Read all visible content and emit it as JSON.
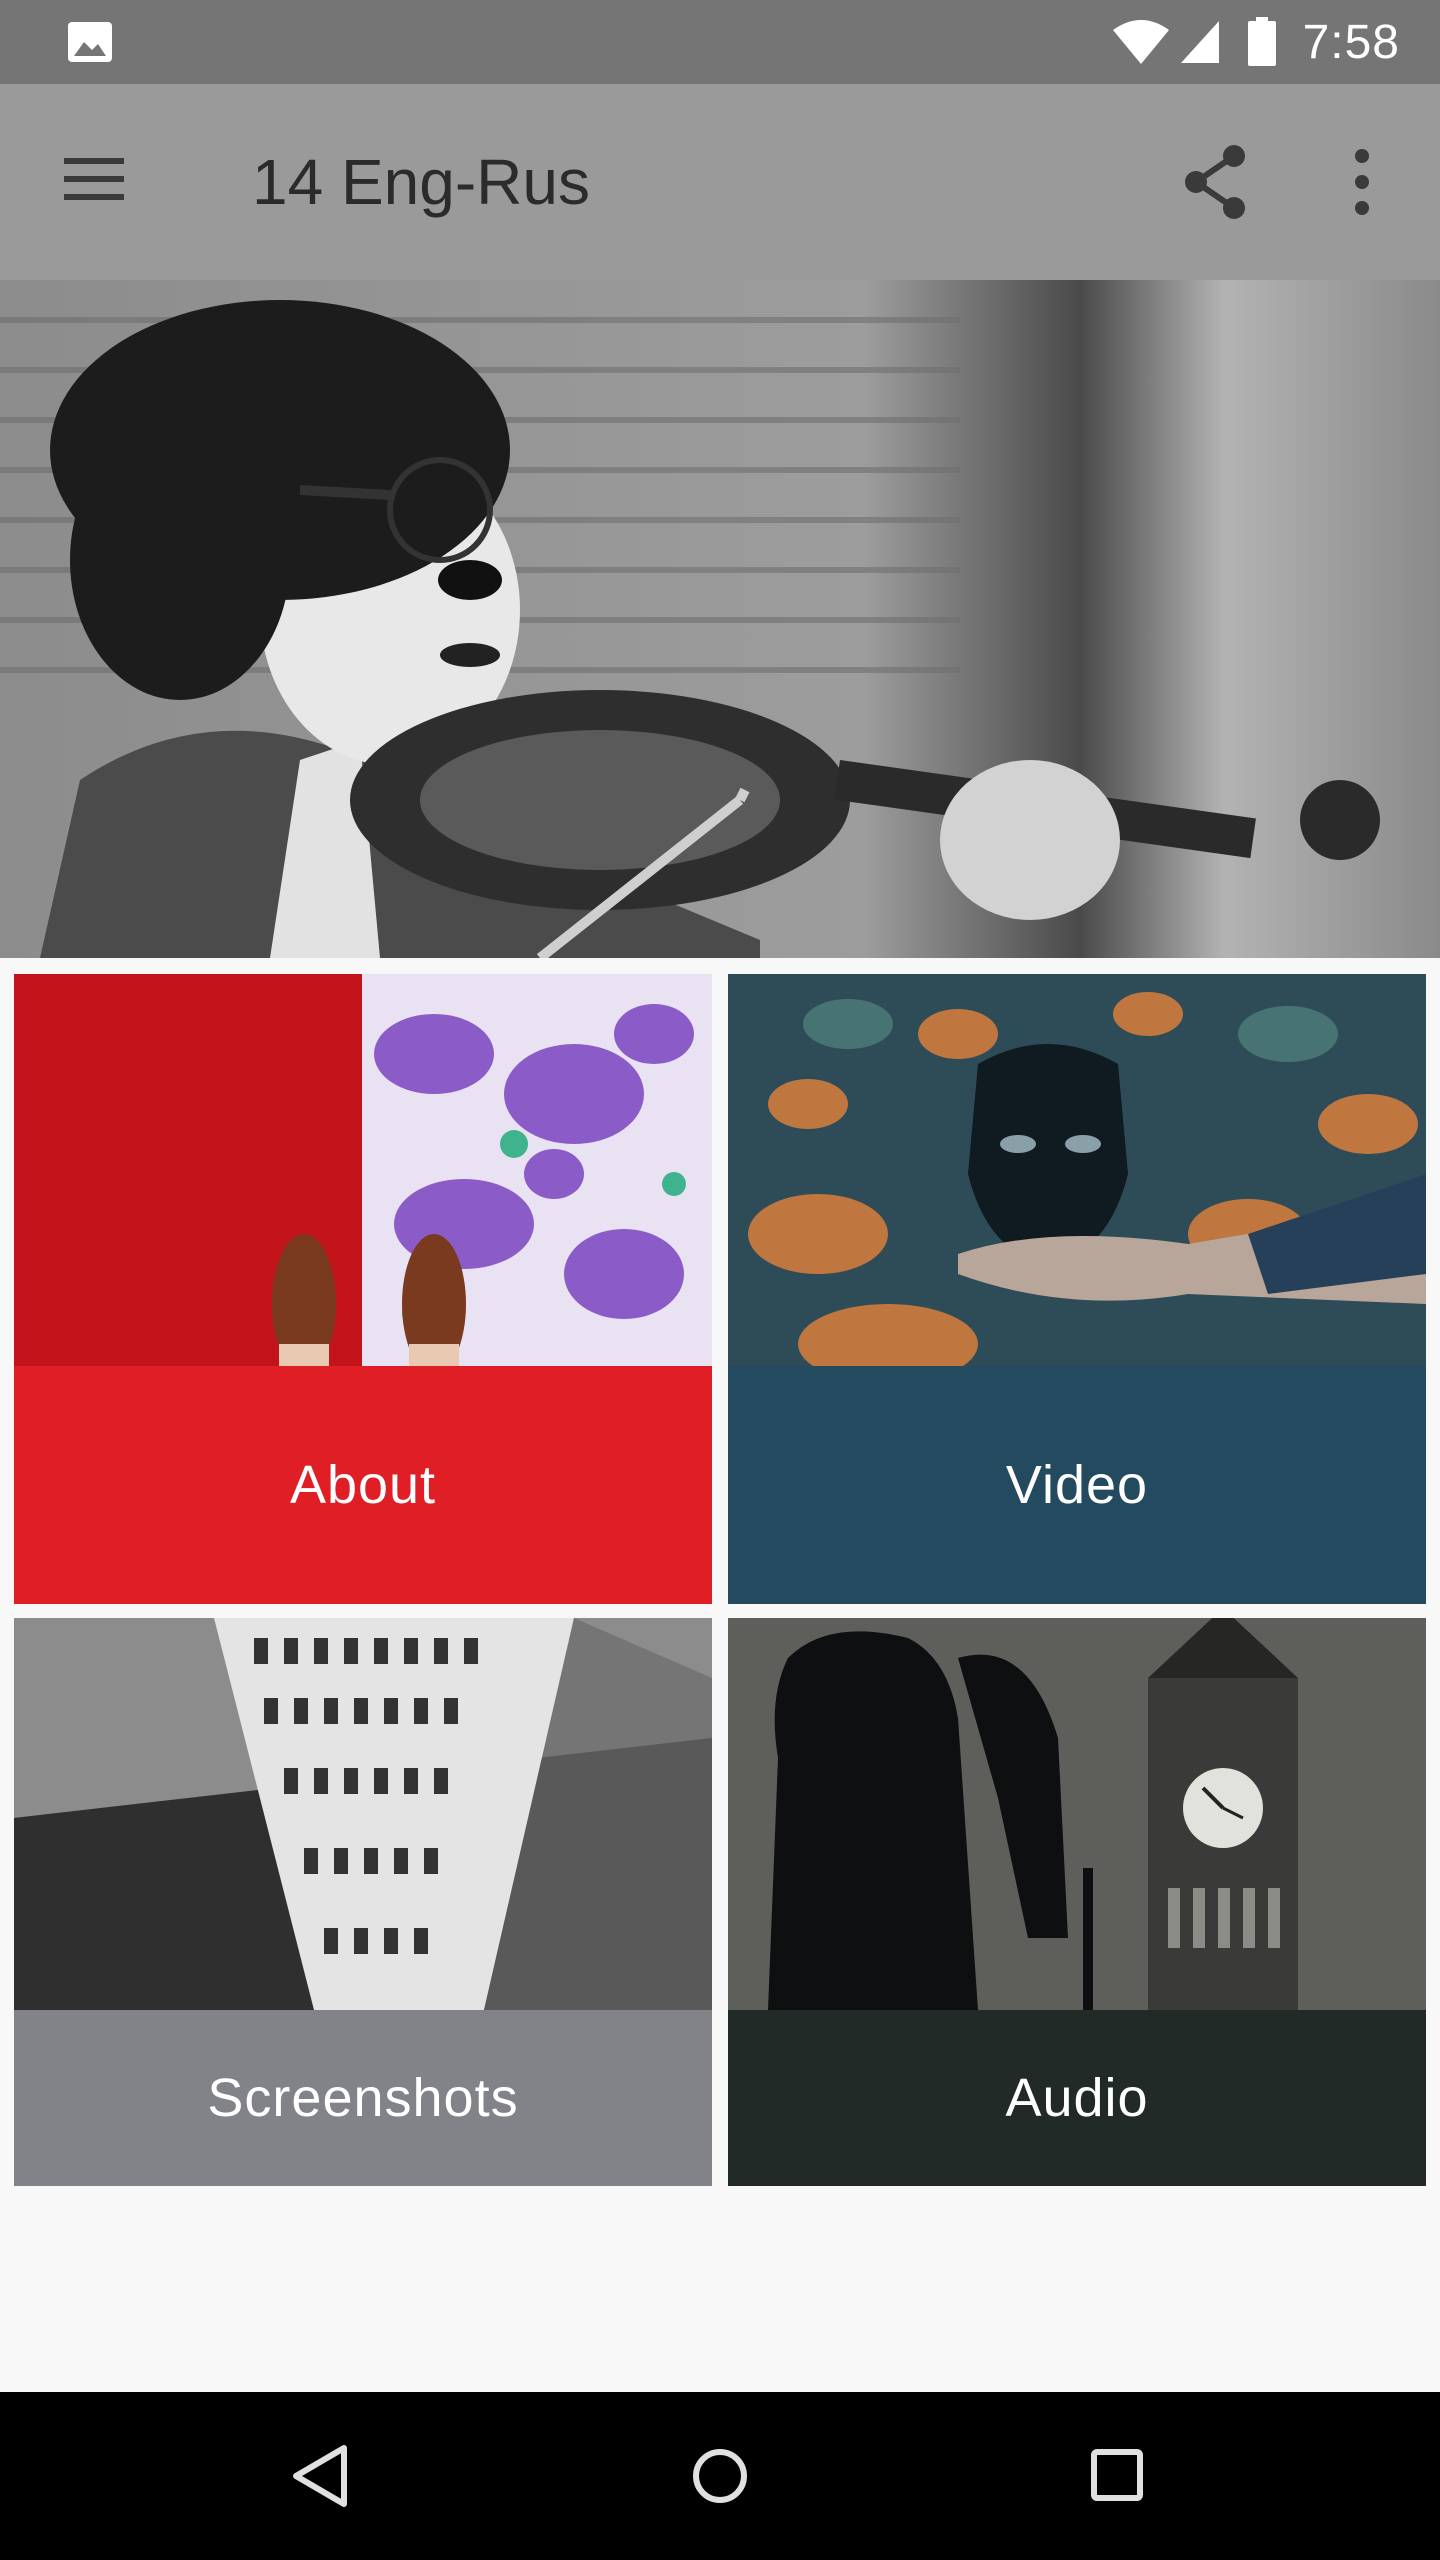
{
  "status_bar": {
    "time": "7:58",
    "icons": [
      "gallery-icon",
      "wifi-icon",
      "signal-icon",
      "battery-icon"
    ]
  },
  "app_bar": {
    "title": "14 Eng-Rus",
    "icons": [
      "menu-icon",
      "share-icon",
      "more-vert-icon"
    ],
    "background": "#9a9a9a"
  },
  "hero": {
    "icon": "violinist-clown-photo"
  },
  "tiles": [
    {
      "label": "About",
      "color": "#e01e25",
      "image": "shoes-on-carpet-photo"
    },
    {
      "label": "Video",
      "color": "#234a5e",
      "image": "black-mask-photo"
    },
    {
      "label": "Screenshots",
      "color": "#828289",
      "image": "building-reflection-photo"
    },
    {
      "label": "Audio",
      "color": "#222a28",
      "image": "big-ben-silhouette-photo"
    }
  ],
  "nav_bar": {
    "icons": [
      "back-icon",
      "home-icon",
      "recents-icon"
    ]
  }
}
